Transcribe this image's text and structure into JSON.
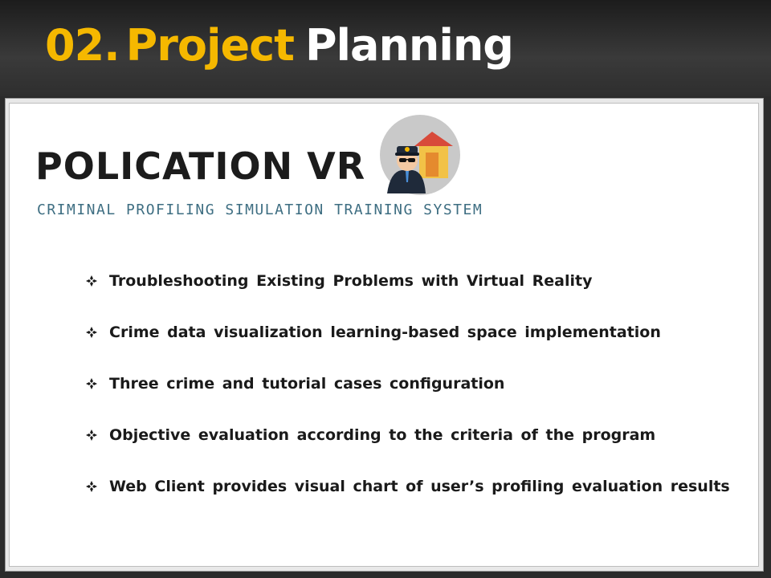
{
  "header": {
    "title_number": "02.",
    "title_word1": "Project",
    "title_word2": "Planning"
  },
  "logo": {
    "name": "POLICATION VR",
    "tagline": "CRIMINAL PROFILING SIMULATION TRAINING SYSTEM",
    "badge_icon": "police-house-icon"
  },
  "bullet_icon": "diamond-bullet-icon",
  "bullets": [
    "Troubleshooting Existing Problems with Virtual Reality",
    "Crime data visualization learning-based space implementation",
    "Three crime and tutorial cases configuration",
    "Objective evaluation according to the criteria of the program",
    "Web Client provides visual chart of user’s profiling evaluation results"
  ],
  "colors": {
    "accent": "#f5b800",
    "header_bg": "#2e2e2e",
    "tagline": "#3e6e82"
  }
}
